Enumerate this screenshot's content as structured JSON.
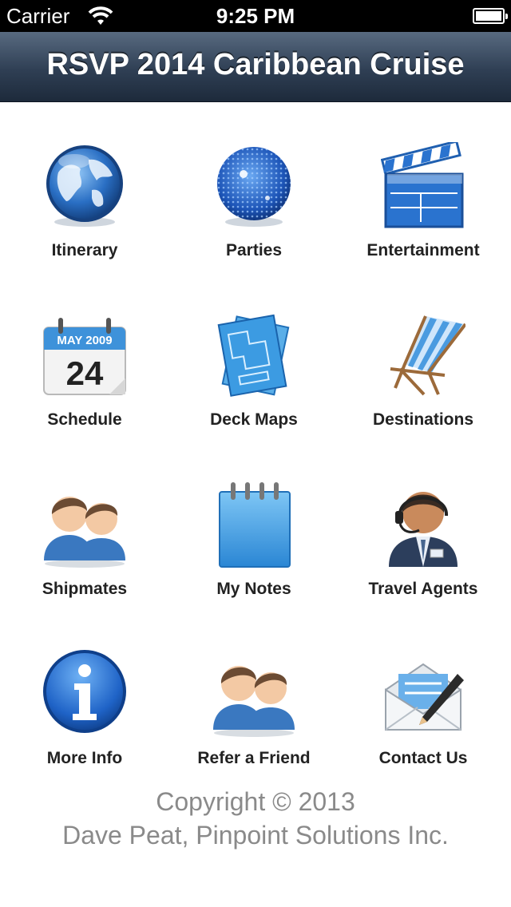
{
  "status_bar": {
    "carrier": "Carrier",
    "time": "9:25 PM"
  },
  "nav": {
    "title": "RSVP 2014 Caribbean Cruise"
  },
  "grid": {
    "items": [
      {
        "label": "Itinerary",
        "icon": "globe-icon"
      },
      {
        "label": "Parties",
        "icon": "disco-ball-icon"
      },
      {
        "label": "Entertainment",
        "icon": "clapperboard-icon"
      },
      {
        "label": "Schedule",
        "icon": "calendar-icon",
        "calendar_month": "MAY 2009",
        "calendar_day": "24"
      },
      {
        "label": "Deck Maps",
        "icon": "deck-map-icon"
      },
      {
        "label": "Destinations",
        "icon": "beach-chair-icon"
      },
      {
        "label": "Shipmates",
        "icon": "people-icon"
      },
      {
        "label": "My Notes",
        "icon": "notepad-icon"
      },
      {
        "label": "Travel Agents",
        "icon": "agent-headset-icon"
      },
      {
        "label": "More Info",
        "icon": "info-icon"
      },
      {
        "label": "Refer a Friend",
        "icon": "people-icon"
      },
      {
        "label": "Contact Us",
        "icon": "envelope-pen-icon"
      }
    ]
  },
  "footer": {
    "copyright": "Copyright © 2013",
    "author": "Dave Peat, Pinpoint Solutions Inc."
  },
  "colors": {
    "nav_bar": "#2f3f54",
    "icon_blue": "#2f7fd0",
    "label_text": "#222222",
    "footer_text": "#8a8a8a"
  }
}
